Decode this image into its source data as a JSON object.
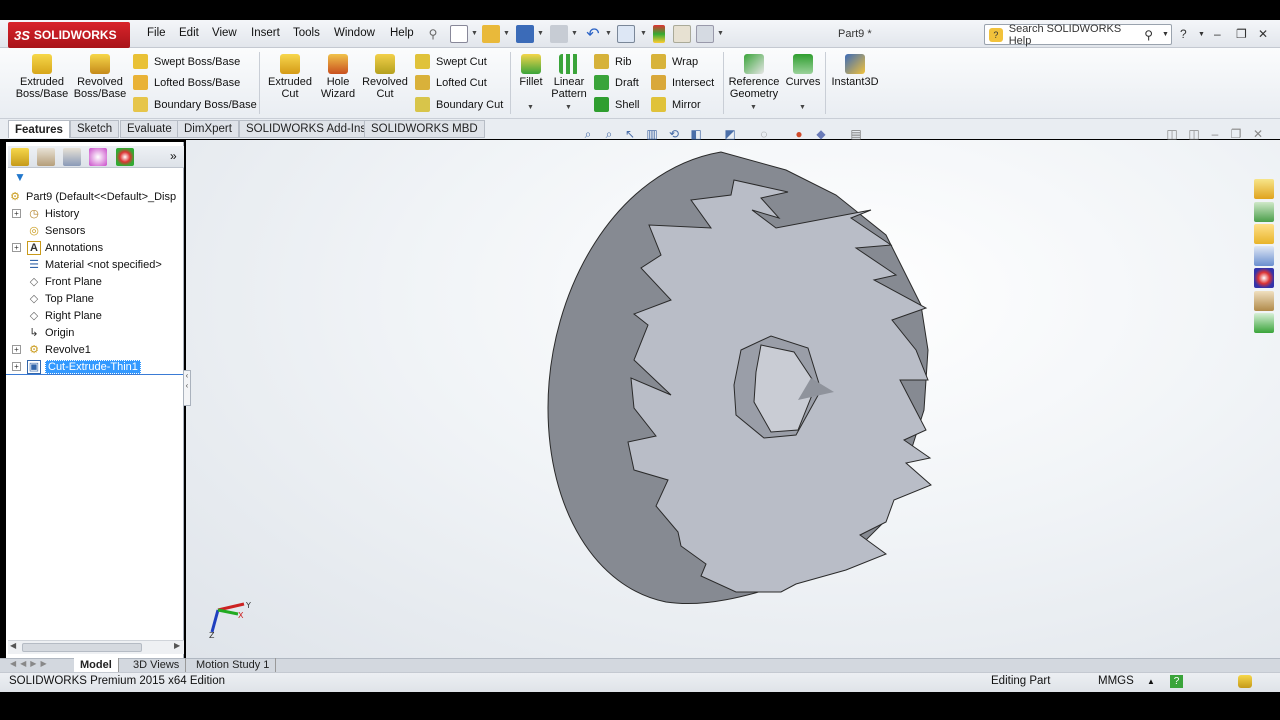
{
  "app": {
    "logo_prefix": "3S",
    "logo": "SOLIDWORKS",
    "doc_title": "Part9 *"
  },
  "menu": [
    "File",
    "Edit",
    "View",
    "Insert",
    "Tools",
    "Window",
    "Help"
  ],
  "search": {
    "placeholder": "Search SOLIDWORKS Help"
  },
  "toolbar": {
    "extruded_boss": "Extruded Boss/Base",
    "revolved_boss": "Revolved Boss/Base",
    "swept_boss": "Swept Boss/Base",
    "lofted_boss": "Lofted Boss/Base",
    "boundary_boss": "Boundary Boss/Base",
    "extruded_cut": "Extruded Cut",
    "hole_wizard": "Hole Wizard",
    "revolved_cut": "Revolved Cut",
    "swept_cut": "Swept Cut",
    "lofted_cut": "Lofted Cut",
    "boundary_cut": "Boundary Cut",
    "fillet": "Fillet",
    "linear_pattern": "Linear Pattern",
    "rib": "Rib",
    "draft": "Draft",
    "shell": "Shell",
    "wrap": "Wrap",
    "intersect": "Intersect",
    "mirror": "Mirror",
    "reference_geometry": "Reference Geometry",
    "curves": "Curves",
    "instant3d": "Instant3D"
  },
  "command_tabs": [
    "Features",
    "Sketch",
    "Evaluate",
    "DimXpert",
    "SOLIDWORKS Add-Ins",
    "SOLIDWORKS MBD"
  ],
  "tree": {
    "root": "Part9  (Default<<Default>_Disp",
    "items": [
      {
        "label": "History",
        "icon": "history-icon"
      },
      {
        "label": "Sensors",
        "icon": "sensors-icon"
      },
      {
        "label": "Annotations",
        "icon": "annotations-icon"
      },
      {
        "label": "Material <not specified>",
        "icon": "material-icon"
      },
      {
        "label": "Front Plane",
        "icon": "plane-icon"
      },
      {
        "label": "Top Plane",
        "icon": "plane-icon"
      },
      {
        "label": "Right Plane",
        "icon": "plane-icon"
      },
      {
        "label": "Origin",
        "icon": "origin-icon"
      },
      {
        "label": "Revolve1",
        "icon": "revolve-icon"
      },
      {
        "label": "Cut-Extrude-Thin1",
        "icon": "cut-extrude-icon"
      }
    ]
  },
  "bottom_tabs": [
    "Model",
    "3D Views",
    "Motion Study 1"
  ],
  "status": {
    "edition": "SOLIDWORKS Premium 2015 x64 Edition",
    "mode": "Editing Part",
    "units": "MMGS"
  },
  "colors": {
    "brand": "#c8161d",
    "selection": "#3399ff",
    "part_face": "#b8bcc6",
    "part_side": "#858991"
  }
}
